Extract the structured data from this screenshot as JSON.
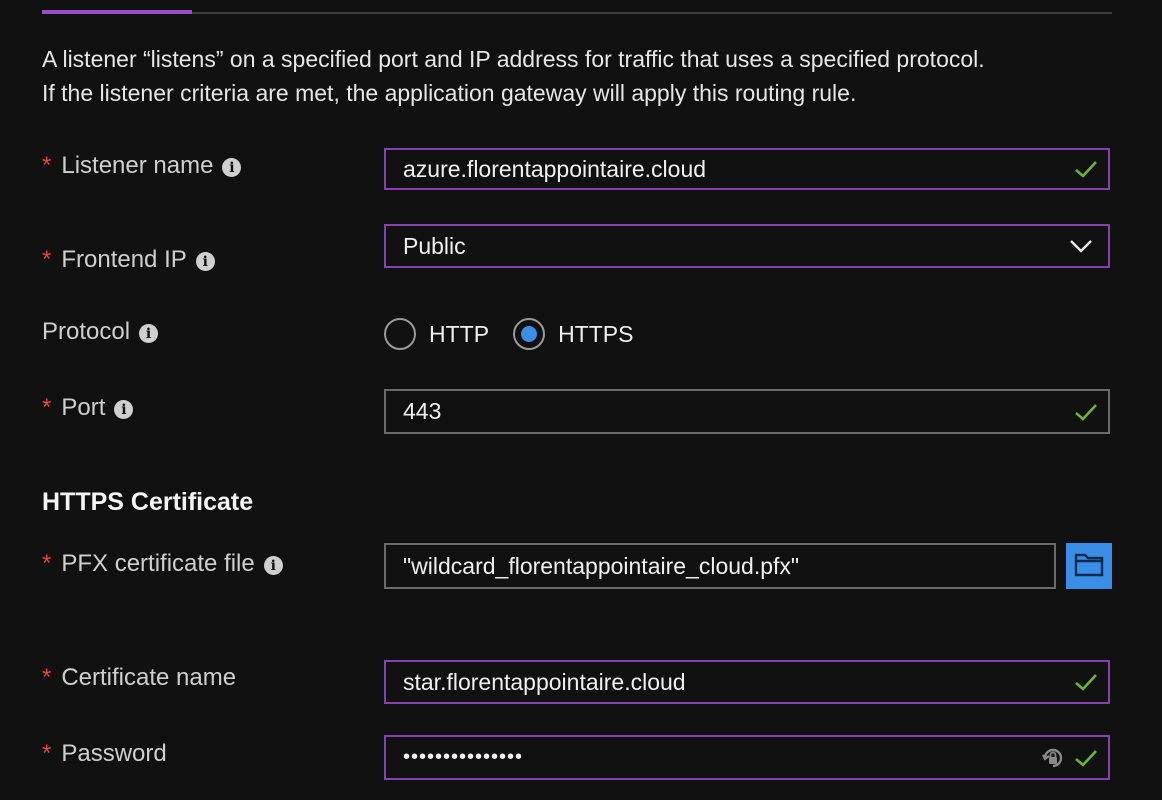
{
  "description": {
    "line1": "A listener “listens” on a specified port and IP address for traffic that uses a specified protocol.",
    "line2": "If the listener criteria are met, the application gateway will apply this routing rule."
  },
  "required_marker": "*",
  "info_glyph": "i",
  "listener_name": {
    "label": "Listener name",
    "value": "azure.florentappointaire.cloud"
  },
  "frontend_ip": {
    "label": "Frontend IP",
    "value": "Public"
  },
  "protocol": {
    "label": "Protocol",
    "options": [
      "HTTP",
      "HTTPS"
    ],
    "selected": "HTTPS"
  },
  "port": {
    "label": "Port",
    "value": "443"
  },
  "https_certificate": {
    "heading": "HTTPS Certificate",
    "pfx_file": {
      "label": "PFX certificate file",
      "value": "\"wildcard_florentappointaire_cloud.pfx\""
    },
    "certificate_name": {
      "label": "Certificate name",
      "value": "star.florentappointaire.cloud"
    },
    "password": {
      "label": "Password",
      "value": "•••••••••••••••"
    }
  },
  "colors": {
    "accent": "#8a3fb0",
    "required": "#e2483d",
    "valid_check": "#6bb536",
    "radio_selected": "#3a8ee6",
    "browse_button": "#3b8ee8"
  },
  "icons": [
    "info-icon",
    "checkmark-icon",
    "chevron-down-icon",
    "folder-icon",
    "password-reveal-icon"
  ]
}
